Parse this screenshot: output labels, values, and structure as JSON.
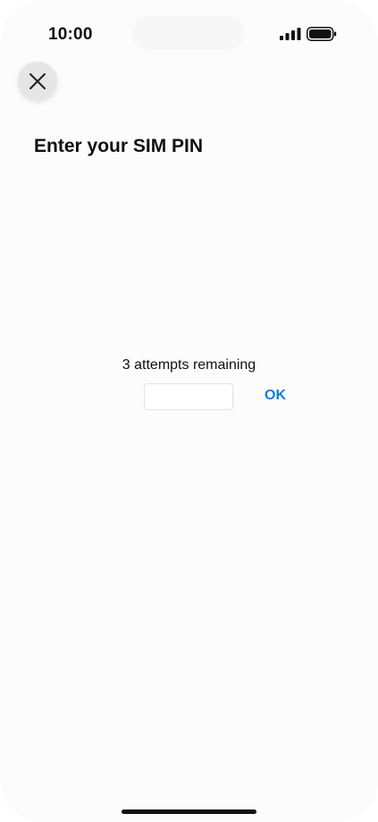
{
  "status_bar": {
    "time": "10:00",
    "signal_icon": "cellular-signal-icon",
    "battery_icon": "battery-full-icon"
  },
  "header": {
    "close_icon": "close-icon"
  },
  "main": {
    "title": "Enter your SIM PIN",
    "attempts_text": "3 attempts remaining",
    "pin_input": {
      "value": "",
      "placeholder": ""
    },
    "ok_label": "OK"
  },
  "colors": {
    "accent": "#0a7fd8",
    "background": "#fcfcfc",
    "close_button_bg": "#e6e6e6",
    "text": "#111111"
  }
}
